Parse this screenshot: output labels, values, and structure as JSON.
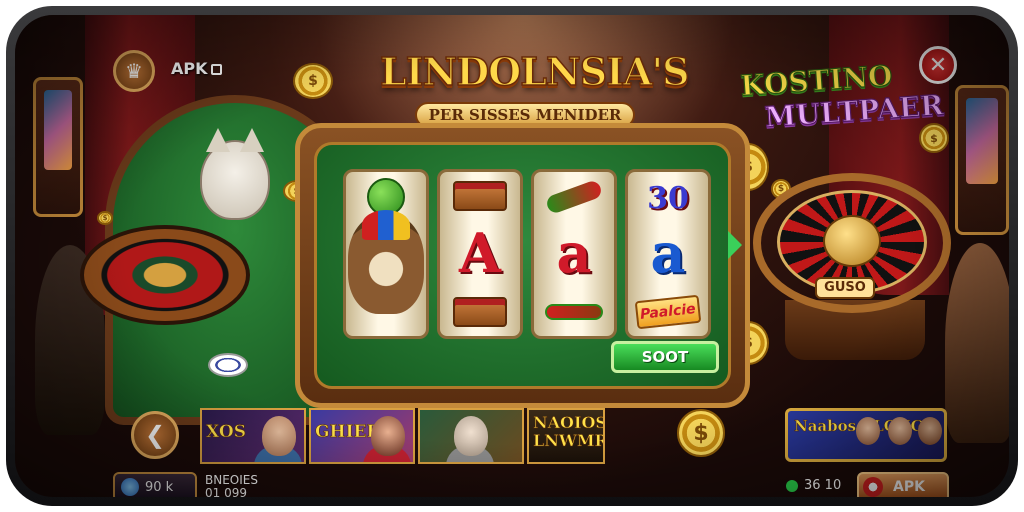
{
  "header": {
    "menu_icon": "grid-logo-icon",
    "menu_glyph": "♛",
    "apk_label": "APK",
    "apk_icon": "external-box-icon",
    "title_main": "LINDOLNSIA'S",
    "title_sub": "PER SISSES MENIDER",
    "title_right_1": "KOSTINO",
    "title_right_2": "MULTPAER",
    "close_icon": "close-x-icon",
    "close_glyph": "✕"
  },
  "slot_machine": {
    "reels": [
      [
        "lime-fruit",
        "raccoon-mascot"
      ],
      [
        "food-box",
        "A",
        "food-box"
      ],
      [
        "chili-pepper",
        "a",
        "chili-sausage"
      ],
      [
        "30",
        "a",
        "label"
      ]
    ],
    "reel2_letter": "A",
    "reel3_top_text": "",
    "reel3_letter": "a",
    "reel4_top_text": "30",
    "reel4_letter": "a",
    "reel4_label": "Paalcie",
    "spin_label": "SOOT"
  },
  "table": {
    "roulette_label": "GUSO"
  },
  "coins": {
    "glyph": "$"
  },
  "bottom_bar": {
    "back_icon": "back-arrow-icon",
    "back_glyph": "❮",
    "games": [
      {
        "title": "XOS"
      },
      {
        "title": "GHIEE"
      },
      {
        "title": ""
      },
      {
        "title": "NAOIOS LNWMRS"
      }
    ],
    "promo_title": "Naabos CLONG",
    "balance_icon": "balance-coin-icon",
    "balance_value": "90 k",
    "user_line_1": "BNEOIES",
    "user_line_2": "01 099",
    "stat_icon": "online-dot-icon",
    "stat_value": "36 10",
    "apk_button_label": "APK",
    "apk_button_icon": "chip-icon"
  },
  "colors": {
    "felt": "#2e8a3a",
    "gold": "#ffd84a",
    "spin": "#2ab03a",
    "close": "#d02020"
  }
}
